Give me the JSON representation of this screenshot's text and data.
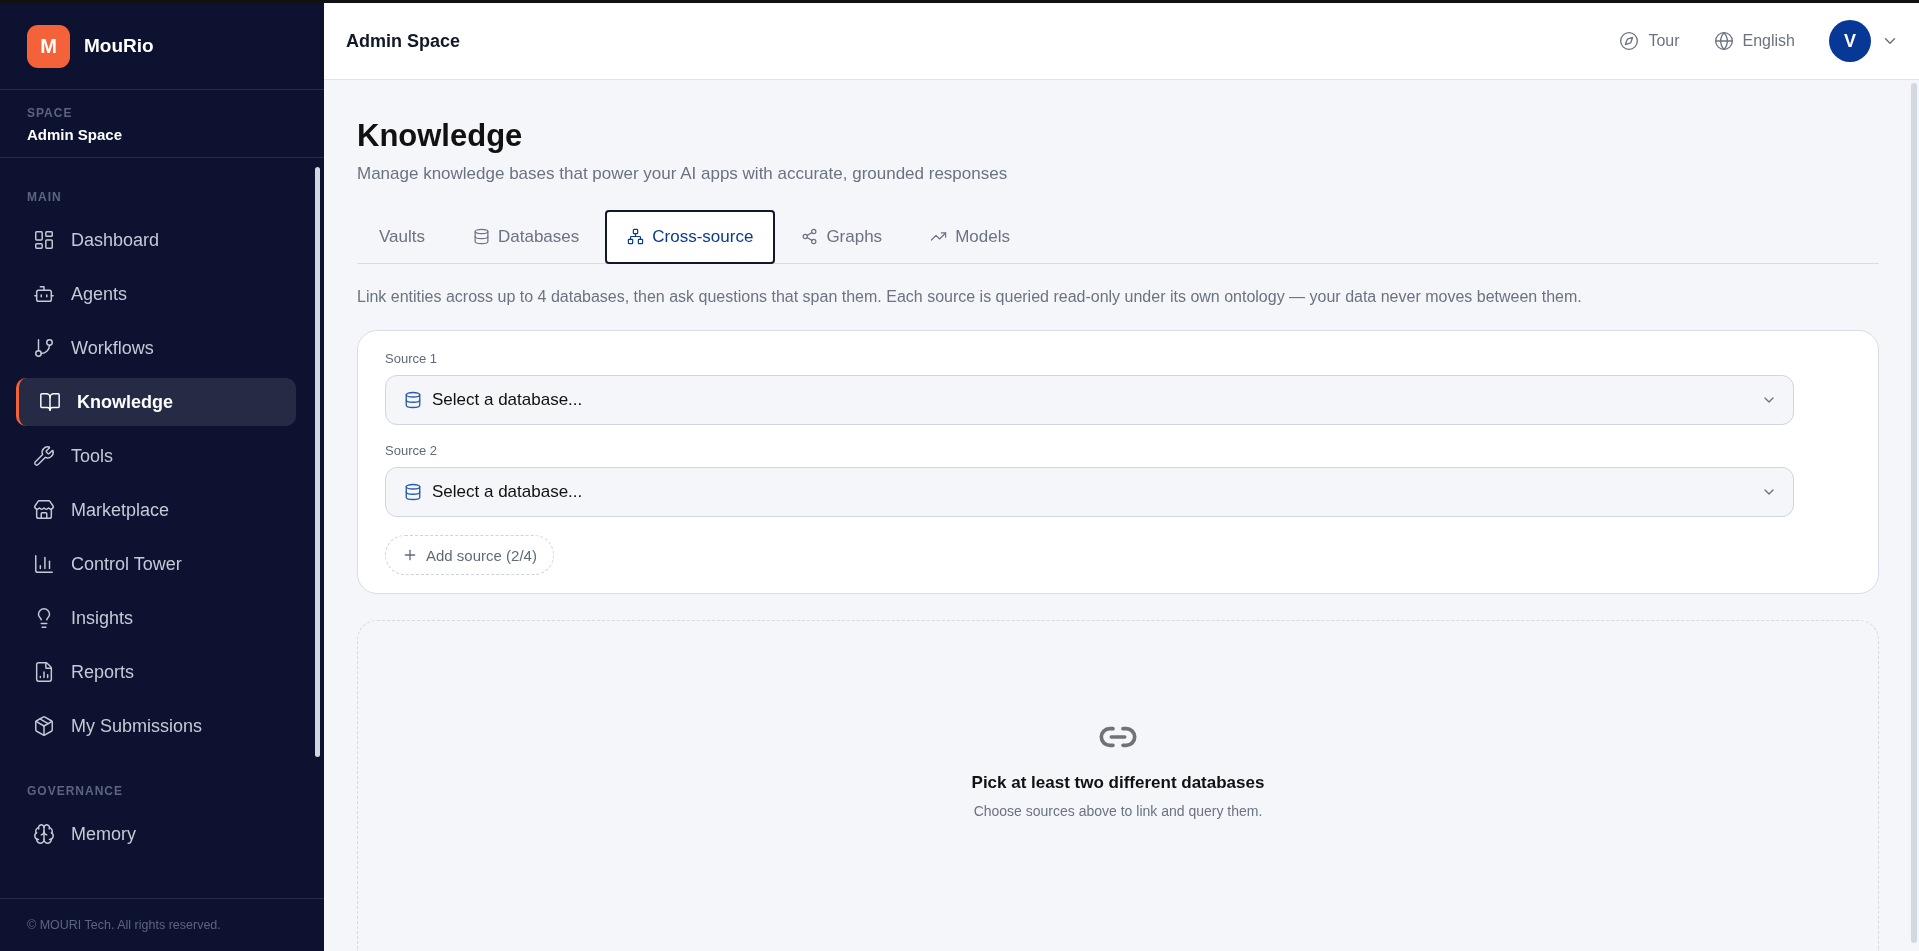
{
  "brand": {
    "logo_letter": "M",
    "name": "MouRio"
  },
  "space": {
    "label": "SPACE",
    "name": "Admin Space"
  },
  "sidebar": {
    "sections": [
      {
        "title": "MAIN",
        "items": [
          {
            "label": "Dashboard",
            "selected": false
          },
          {
            "label": "Agents",
            "selected": false
          },
          {
            "label": "Workflows",
            "selected": false
          },
          {
            "label": "Knowledge",
            "selected": true
          },
          {
            "label": "Tools",
            "selected": false
          },
          {
            "label": "Marketplace",
            "selected": false
          },
          {
            "label": "Control Tower",
            "selected": false
          },
          {
            "label": "Insights",
            "selected": false
          },
          {
            "label": "Reports",
            "selected": false
          },
          {
            "label": "My Submissions",
            "selected": false
          }
        ]
      },
      {
        "title": "GOVERNANCE",
        "items": [
          {
            "label": "Memory",
            "selected": false
          }
        ]
      }
    ]
  },
  "footer": "© MOURI Tech. All rights reserved.",
  "header": {
    "title": "Admin Space",
    "tour": "Tour",
    "language": "English",
    "avatar": "V"
  },
  "page": {
    "title": "Knowledge",
    "subtitle": "Manage knowledge bases that power your AI apps with accurate, grounded responses"
  },
  "tabs": [
    {
      "label": "Vaults",
      "selected": false
    },
    {
      "label": "Databases",
      "selected": false
    },
    {
      "label": "Cross-source",
      "selected": true
    },
    {
      "label": "Graphs",
      "selected": false
    },
    {
      "label": "Models",
      "selected": false
    }
  ],
  "description": "Link entities across up to 4 databases, then ask questions that span them. Each source is queried read-only under its own ontology — your data never moves between them.",
  "sources": [
    {
      "label": "Source 1",
      "placeholder": "Select a database..."
    },
    {
      "label": "Source 2",
      "placeholder": "Select a database..."
    }
  ],
  "add_source": "Add source (2/4)",
  "empty_state": {
    "title": "Pick at least two different databases",
    "text": "Choose sources above to link and query them."
  }
}
